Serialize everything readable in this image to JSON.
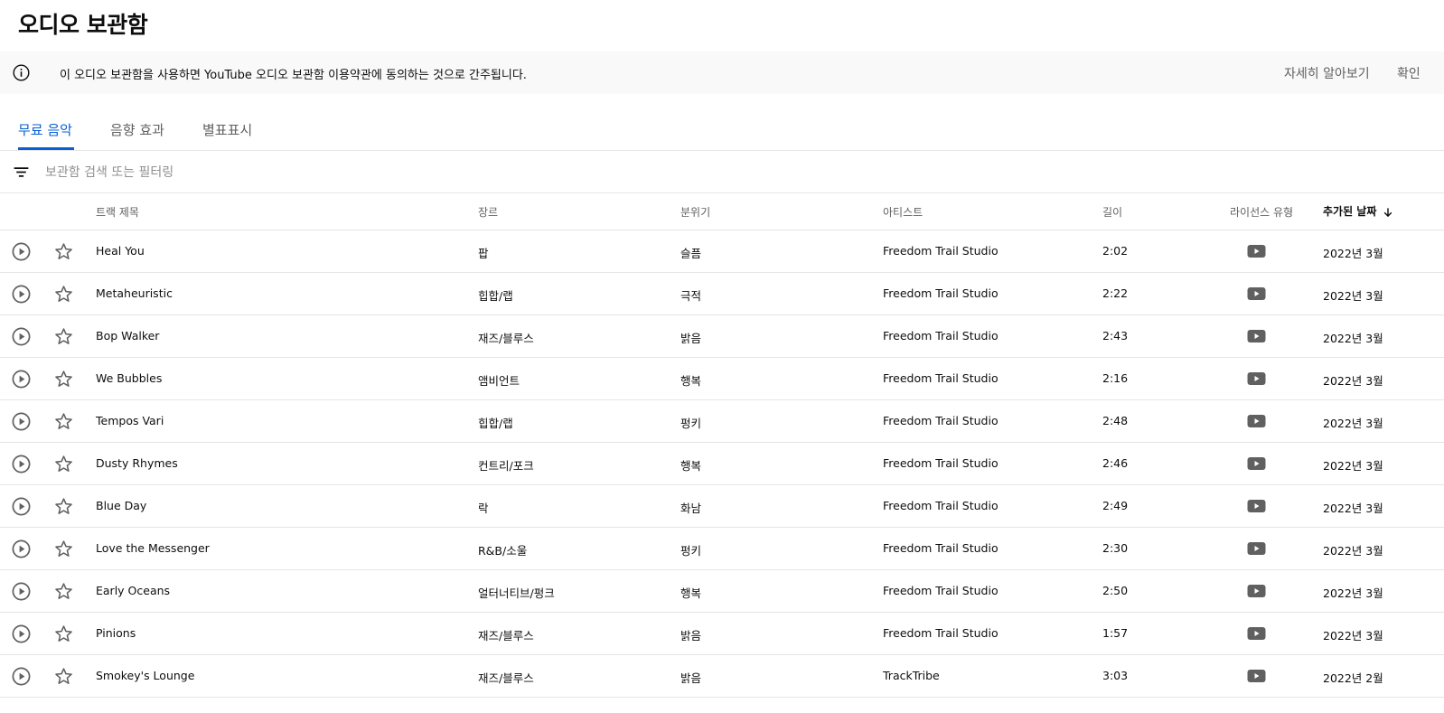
{
  "page": {
    "title": "오디오 보관함"
  },
  "banner": {
    "text": "이 오디오 보관함을 사용하면 YouTube 오디오 보관함 이용약관에 동의하는 것으로 간주됩니다.",
    "learn_more": "자세히 알아보기",
    "confirm": "확인"
  },
  "tabs": [
    {
      "label": "무료 음악",
      "active": true
    },
    {
      "label": "음향 효과",
      "active": false
    },
    {
      "label": "별표표시",
      "active": false
    }
  ],
  "filter": {
    "placeholder": "보관함 검색 또는 필터링",
    "value": ""
  },
  "table": {
    "columns": {
      "title": "트랙 제목",
      "genre": "장르",
      "mood": "분위기",
      "artist": "아티스트",
      "duration": "길이",
      "license": "라이선스 유형",
      "added": "추가된 날짜"
    },
    "sort": {
      "column": "added",
      "direction": "descending"
    },
    "rows": [
      {
        "title": "Heal You",
        "genre": "팝",
        "mood": "슬픔",
        "artist": "Freedom Trail Studio",
        "duration": "2:02",
        "license_icon": "youtube-icon",
        "added": "2022년 3월"
      },
      {
        "title": "Metaheuristic",
        "genre": "힙합/랩",
        "mood": "극적",
        "artist": "Freedom Trail Studio",
        "duration": "2:22",
        "license_icon": "youtube-icon",
        "added": "2022년 3월"
      },
      {
        "title": "Bop Walker",
        "genre": "재즈/블루스",
        "mood": "밝음",
        "artist": "Freedom Trail Studio",
        "duration": "2:43",
        "license_icon": "youtube-icon",
        "added": "2022년 3월"
      },
      {
        "title": "We Bubbles",
        "genre": "앰비언트",
        "mood": "행복",
        "artist": "Freedom Trail Studio",
        "duration": "2:16",
        "license_icon": "youtube-icon",
        "added": "2022년 3월"
      },
      {
        "title": "Tempos Vari",
        "genre": "힙합/랩",
        "mood": "펑키",
        "artist": "Freedom Trail Studio",
        "duration": "2:48",
        "license_icon": "youtube-icon",
        "added": "2022년 3월"
      },
      {
        "title": "Dusty Rhymes",
        "genre": "컨트리/포크",
        "mood": "행복",
        "artist": "Freedom Trail Studio",
        "duration": "2:46",
        "license_icon": "youtube-icon",
        "added": "2022년 3월"
      },
      {
        "title": "Blue Day",
        "genre": "락",
        "mood": "화남",
        "artist": "Freedom Trail Studio",
        "duration": "2:49",
        "license_icon": "youtube-icon",
        "added": "2022년 3월"
      },
      {
        "title": "Love the Messenger",
        "genre": "R&B/소울",
        "mood": "펑키",
        "artist": "Freedom Trail Studio",
        "duration": "2:30",
        "license_icon": "youtube-icon",
        "added": "2022년 3월"
      },
      {
        "title": "Early Oceans",
        "genre": "얼터너티브/펑크",
        "mood": "행복",
        "artist": "Freedom Trail Studio",
        "duration": "2:50",
        "license_icon": "youtube-icon",
        "added": "2022년 3월"
      },
      {
        "title": "Pinions",
        "genre": "재즈/블루스",
        "mood": "밝음",
        "artist": "Freedom Trail Studio",
        "duration": "1:57",
        "license_icon": "youtube-icon",
        "added": "2022년 3월"
      },
      {
        "title": "Smokey's Lounge",
        "genre": "재즈/블루스",
        "mood": "밝음",
        "artist": "TrackTribe",
        "duration": "3:03",
        "license_icon": "youtube-icon",
        "added": "2022년 2월"
      }
    ]
  },
  "colors": {
    "accent": "#065fd4",
    "text": "#0d0d0d",
    "secondary": "#606060",
    "icon": "#606060",
    "banner_bg": "#f9f9f9",
    "divider": "#e5e5e5"
  }
}
